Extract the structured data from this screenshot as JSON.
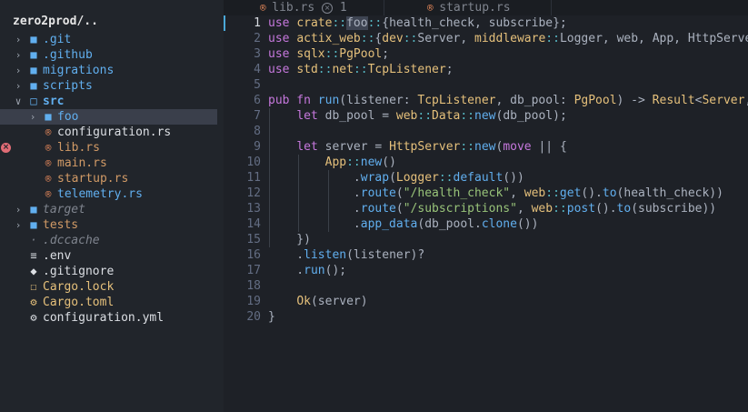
{
  "project": {
    "title": "zero2prod/.."
  },
  "tree": [
    {
      "type": "folder",
      "label": ".git",
      "expanded": false,
      "depth": 1,
      "style": "dir",
      "icon": "folder-icon"
    },
    {
      "type": "folder",
      "label": ".github",
      "expanded": false,
      "depth": 1,
      "style": "dir",
      "icon": "folder-icon"
    },
    {
      "type": "folder",
      "label": "migrations",
      "expanded": false,
      "depth": 1,
      "style": "dir",
      "icon": "folder-icon"
    },
    {
      "type": "folder",
      "label": "scripts",
      "expanded": false,
      "depth": 1,
      "style": "dir",
      "icon": "folder-icon"
    },
    {
      "type": "folder",
      "label": "src",
      "expanded": true,
      "depth": 1,
      "style": "src",
      "icon": "folder-open-icon"
    },
    {
      "type": "folder",
      "label": "foo",
      "expanded": false,
      "depth": 2,
      "style": "foo",
      "icon": "folder-icon",
      "selected": true
    },
    {
      "type": "file",
      "label": "configuration.rs",
      "depth": 2,
      "style": "plain",
      "icon": "rust-file-icon"
    },
    {
      "type": "file",
      "label": "lib.rs",
      "depth": 2,
      "style": "rs",
      "icon": "rust-file-icon",
      "error": true
    },
    {
      "type": "file",
      "label": "main.rs",
      "depth": 2,
      "style": "rs",
      "icon": "rust-file-icon"
    },
    {
      "type": "file",
      "label": "startup.rs",
      "depth": 2,
      "style": "rs",
      "icon": "rust-file-icon"
    },
    {
      "type": "file",
      "label": "telemetry.rs",
      "depth": 2,
      "style": "dir",
      "icon": "rust-file-icon"
    },
    {
      "type": "folder",
      "label": "target",
      "expanded": false,
      "depth": 1,
      "style": "dim",
      "icon": "folder-icon"
    },
    {
      "type": "folder",
      "label": "tests",
      "expanded": false,
      "depth": 1,
      "style": "rs",
      "icon": "folder-icon"
    },
    {
      "type": "file",
      "label": ".dccache",
      "depth": 1,
      "style": "dim",
      "icon": "file-icon"
    },
    {
      "type": "file",
      "label": ".env",
      "depth": 1,
      "style": "plain",
      "icon": "settings-sliders-icon"
    },
    {
      "type": "file",
      "label": ".gitignore",
      "depth": 1,
      "style": "plain",
      "icon": "git-diamond-icon"
    },
    {
      "type": "file",
      "label": "Cargo.lock",
      "depth": 1,
      "style": "lock",
      "icon": "lock-icon"
    },
    {
      "type": "file",
      "label": "Cargo.toml",
      "depth": 1,
      "style": "lock",
      "icon": "gear-icon"
    },
    {
      "type": "file",
      "label": "configuration.yml",
      "depth": 1,
      "style": "plain",
      "icon": "gear-icon"
    }
  ],
  "tabs": [
    {
      "label": "lib.rs",
      "badge": "×",
      "count": "1",
      "icon": "rust-file-icon"
    },
    {
      "label": "startup.rs",
      "icon": "rust-file-icon",
      "active": true
    }
  ],
  "editor": {
    "current_line": 1,
    "lines": [
      [
        [
          "kw",
          "use "
        ],
        [
          "ns",
          "crate"
        ],
        [
          "op",
          "::"
        ],
        [
          "hl",
          "foo"
        ],
        [
          "op",
          "::"
        ],
        [
          "pun",
          "{"
        ],
        [
          "pun",
          "health_check, subscribe"
        ],
        [
          "pun",
          "};"
        ]
      ],
      [
        [
          "kw",
          "use "
        ],
        [
          "ns",
          "actix_web"
        ],
        [
          "op",
          "::"
        ],
        [
          "pun",
          "{"
        ],
        [
          "ns",
          "dev"
        ],
        [
          "op",
          "::"
        ],
        [
          "pun",
          "Server, "
        ],
        [
          "ns",
          "middleware"
        ],
        [
          "op",
          "::"
        ],
        [
          "pun",
          "Logger, web, App, HttpServer}"
        ]
      ],
      [
        [
          "kw",
          "use "
        ],
        [
          "ns",
          "sqlx"
        ],
        [
          "op",
          "::"
        ],
        [
          "ty",
          "PgPool"
        ],
        [
          "pun",
          ";"
        ]
      ],
      [
        [
          "kw",
          "use "
        ],
        [
          "ns",
          "std"
        ],
        [
          "op",
          "::"
        ],
        [
          "ns",
          "net"
        ],
        [
          "op",
          "::"
        ],
        [
          "ty",
          "TcpListener"
        ],
        [
          "pun",
          ";"
        ]
      ],
      [],
      [
        [
          "kw",
          "pub fn "
        ],
        [
          "fn",
          "run"
        ],
        [
          "pun",
          "(listener: "
        ],
        [
          "ty",
          "TcpListener"
        ],
        [
          "pun",
          ", db_pool: "
        ],
        [
          "ty",
          "PgPool"
        ],
        [
          "pun",
          ") -> "
        ],
        [
          "ty",
          "Result"
        ],
        [
          "pun",
          "<"
        ],
        [
          "ty",
          "Server"
        ],
        [
          "pun",
          ", std::io::Error> {"
        ]
      ],
      [
        [
          "pun",
          "    "
        ],
        [
          "kw",
          "let "
        ],
        [
          "pun",
          "db_pool = "
        ],
        [
          "ns",
          "web"
        ],
        [
          "op",
          "::"
        ],
        [
          "ty",
          "Data"
        ],
        [
          "op",
          "::"
        ],
        [
          "fn",
          "new"
        ],
        [
          "pun",
          "(db_pool);"
        ]
      ],
      [],
      [
        [
          "pun",
          "    "
        ],
        [
          "kw",
          "let "
        ],
        [
          "pun",
          "server = "
        ],
        [
          "ty",
          "HttpServer"
        ],
        [
          "op",
          "::"
        ],
        [
          "fn",
          "new"
        ],
        [
          "pun",
          "("
        ],
        [
          "kw",
          "move "
        ],
        [
          "pun",
          "|| {"
        ]
      ],
      [
        [
          "pun",
          "        "
        ],
        [
          "ty",
          "App"
        ],
        [
          "op",
          "::"
        ],
        [
          "fn",
          "new"
        ],
        [
          "pun",
          "()"
        ]
      ],
      [
        [
          "pun",
          "            ."
        ],
        [
          "fn",
          "wrap"
        ],
        [
          "pun",
          "("
        ],
        [
          "ty",
          "Logger"
        ],
        [
          "op",
          "::"
        ],
        [
          "fn",
          "default"
        ],
        [
          "pun",
          "())"
        ]
      ],
      [
        [
          "pun",
          "            ."
        ],
        [
          "fn",
          "route"
        ],
        [
          "pun",
          "("
        ],
        [
          "str",
          "\"/health_check\""
        ],
        [
          "pun",
          ", "
        ],
        [
          "ns",
          "web"
        ],
        [
          "op",
          "::"
        ],
        [
          "fn",
          "get"
        ],
        [
          "pun",
          "()."
        ],
        [
          "fn",
          "to"
        ],
        [
          "pun",
          "(health_check))"
        ]
      ],
      [
        [
          "pun",
          "            ."
        ],
        [
          "fn",
          "route"
        ],
        [
          "pun",
          "("
        ],
        [
          "str",
          "\"/subscriptions\""
        ],
        [
          "pun",
          ", "
        ],
        [
          "ns",
          "web"
        ],
        [
          "op",
          "::"
        ],
        [
          "fn",
          "post"
        ],
        [
          "pun",
          "()."
        ],
        [
          "fn",
          "to"
        ],
        [
          "pun",
          "(subscribe))"
        ]
      ],
      [
        [
          "pun",
          "            ."
        ],
        [
          "fn",
          "app_data"
        ],
        [
          "pun",
          "(db_pool."
        ],
        [
          "fn",
          "clone"
        ],
        [
          "pun",
          "())"
        ]
      ],
      [
        [
          "pun",
          "    })"
        ]
      ],
      [
        [
          "pun",
          "    ."
        ],
        [
          "fn",
          "listen"
        ],
        [
          "pun",
          "(listener)?"
        ]
      ],
      [
        [
          "pun",
          "    ."
        ],
        [
          "fn",
          "run"
        ],
        [
          "pun",
          "();"
        ]
      ],
      [],
      [
        [
          "pun",
          "    "
        ],
        [
          "ty",
          "Ok"
        ],
        [
          "pun",
          "(server)"
        ]
      ],
      [
        [
          "pun",
          "}"
        ]
      ]
    ]
  },
  "colors": {
    "accent": "#61afef",
    "error": "#e06c75",
    "keyword": "#c678dd",
    "string": "#98c379",
    "type": "#e5c07b"
  }
}
